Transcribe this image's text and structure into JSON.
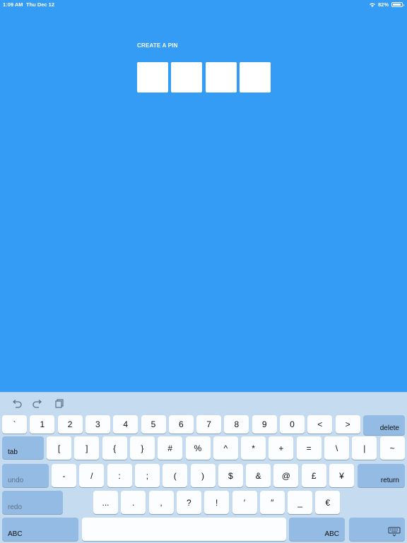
{
  "status": {
    "time": "1:09 AM",
    "date": "Thu Dec 12",
    "battery": "82%",
    "battery_level": 0.82
  },
  "pin": {
    "title": "CREATE A PIN",
    "digits": [
      "",
      "",
      "",
      ""
    ]
  },
  "keyboard": {
    "toolbar": [
      "undo-icon",
      "redo-icon",
      "paste-icon"
    ],
    "row1": [
      "`",
      "1",
      "2",
      "3",
      "4",
      "5",
      "6",
      "7",
      "8",
      "9",
      "0",
      "<",
      ">"
    ],
    "delete": "delete",
    "tab": "tab",
    "row2": [
      "[",
      "]",
      "{",
      "}",
      "#",
      "%",
      "^",
      "*",
      "+",
      "=",
      "\\",
      "|",
      "~"
    ],
    "undo": "undo",
    "row3": [
      "-",
      "/",
      ":",
      ";",
      "(",
      ")",
      "$",
      "&",
      "@",
      "£",
      "¥"
    ],
    "return": "return",
    "redo": "redo",
    "row4": [
      "...",
      ".",
      ",",
      "?",
      "!",
      "′",
      "″",
      "_",
      "€"
    ],
    "abc_left": "ABC",
    "space": "",
    "abc_right": "ABC",
    "dismiss_icon": "keyboard-dismiss-icon"
  }
}
